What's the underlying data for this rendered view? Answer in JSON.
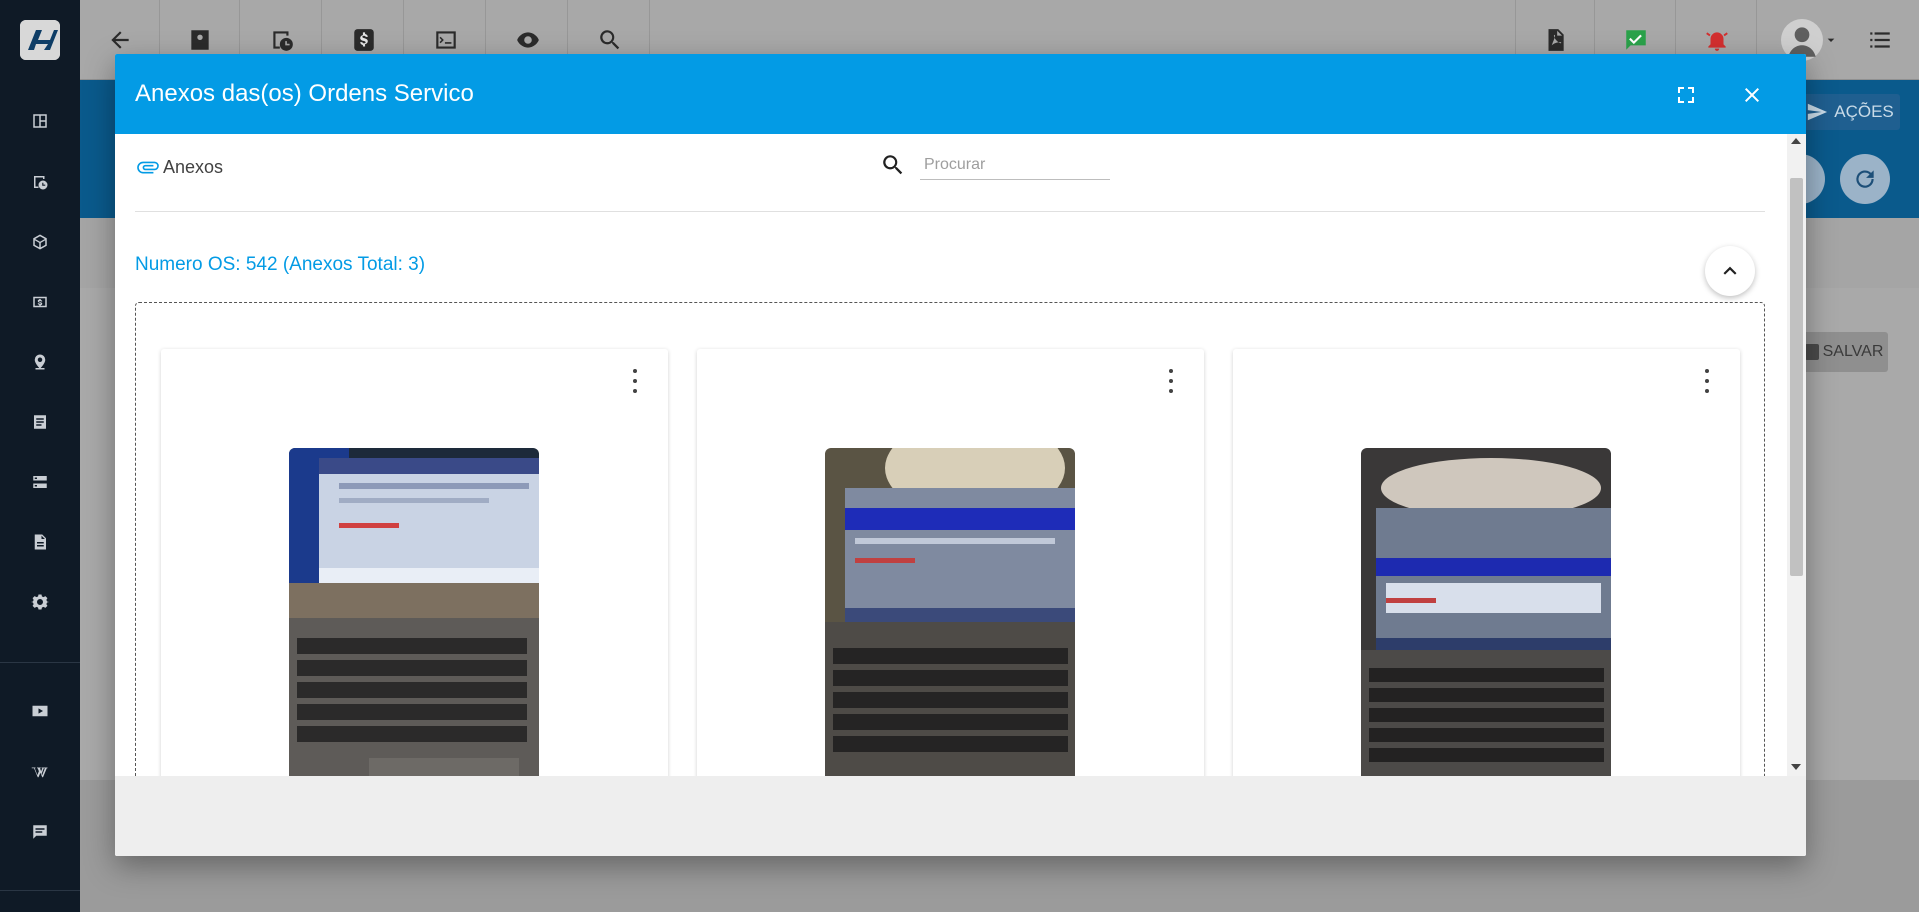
{
  "app": {
    "sidebar_icons": [
      "dashboard-icon",
      "calendar-clock-icon",
      "package-icon",
      "money-icon",
      "location-icon",
      "list-icon",
      "dns-icon",
      "document-icon",
      "gear-icon",
      "video-icon",
      "wikipedia-icon",
      "chat-icon"
    ],
    "toolbar_icons": [
      "back-arrow-icon",
      "contact-icon",
      "schedule-icon",
      "dollar-icon",
      "terminal-icon",
      "eye-icon",
      "search-icon",
      "pdf-icon",
      "check-message-icon",
      "alarm-icon",
      "avatar",
      "list-menu-icon"
    ],
    "acoes_label": "AÇÕES",
    "salvar_label": "SALVAR"
  },
  "modal": {
    "title": "Anexos das(os) Ordens Servico",
    "tab_label": "Anexos",
    "search": {
      "placeholder": "Procurar",
      "value": ""
    },
    "os_title": "Numero OS: 542 (Anexos Total: 3)",
    "attachments": [
      {
        "icon": "laptop-photo"
      },
      {
        "icon": "laptop-photo"
      },
      {
        "icon": "laptop-photo"
      }
    ]
  },
  "colors": {
    "header": "#039be5",
    "accent_text": "#039be5",
    "sidebar": "#0f1a26"
  }
}
